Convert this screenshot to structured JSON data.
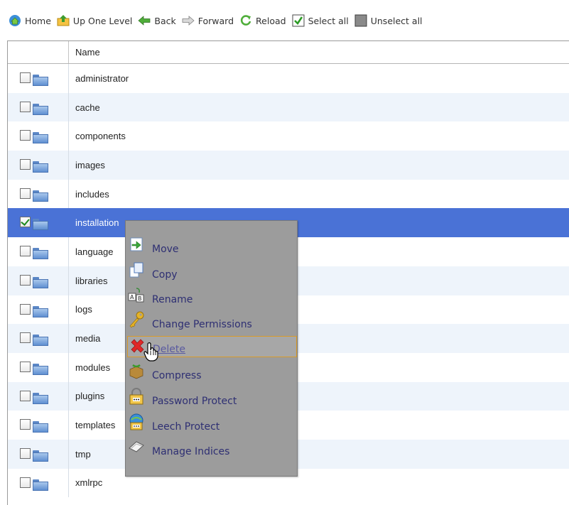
{
  "toolbar": {
    "home": "Home",
    "up": "Up One Level",
    "back": "Back",
    "forward": "Forward",
    "reload": "Reload",
    "select_all": "Select all",
    "unselect_all": "Unselect all"
  },
  "table": {
    "header_name": "Name",
    "rows": [
      {
        "name": "administrator",
        "checked": false
      },
      {
        "name": "cache",
        "checked": false
      },
      {
        "name": "components",
        "checked": false
      },
      {
        "name": "images",
        "checked": false
      },
      {
        "name": "includes",
        "checked": false
      },
      {
        "name": "installation",
        "checked": true
      },
      {
        "name": "language",
        "checked": false
      },
      {
        "name": "libraries",
        "checked": false
      },
      {
        "name": "logs",
        "checked": false
      },
      {
        "name": "media",
        "checked": false
      },
      {
        "name": "modules",
        "checked": false
      },
      {
        "name": "plugins",
        "checked": false
      },
      {
        "name": "templates",
        "checked": false
      },
      {
        "name": "tmp",
        "checked": false
      },
      {
        "name": "xmlrpc",
        "checked": false
      }
    ]
  },
  "context_menu": {
    "items": [
      {
        "label": "Move",
        "icon": "move-icon"
      },
      {
        "label": "Copy",
        "icon": "copy-icon"
      },
      {
        "label": "Rename",
        "icon": "rename-icon"
      },
      {
        "label": "Change Permissions",
        "icon": "key-icon"
      },
      {
        "label": "Delete",
        "icon": "delete-icon"
      },
      {
        "label": "Compress",
        "icon": "compress-icon"
      },
      {
        "label": "Password Protect",
        "icon": "padlock-icon"
      },
      {
        "label": "Leech Protect",
        "icon": "leech-protect-icon"
      },
      {
        "label": "Manage Indices",
        "icon": "manage-indices-icon"
      }
    ],
    "hovered": "Delete"
  },
  "colors": {
    "selected_row": "#4a72d6",
    "alt_row": "#eef4fb",
    "menu_bg": "#9c9c9c",
    "menu_text": "#2e2f73",
    "hover_border": "#d89b2a"
  }
}
